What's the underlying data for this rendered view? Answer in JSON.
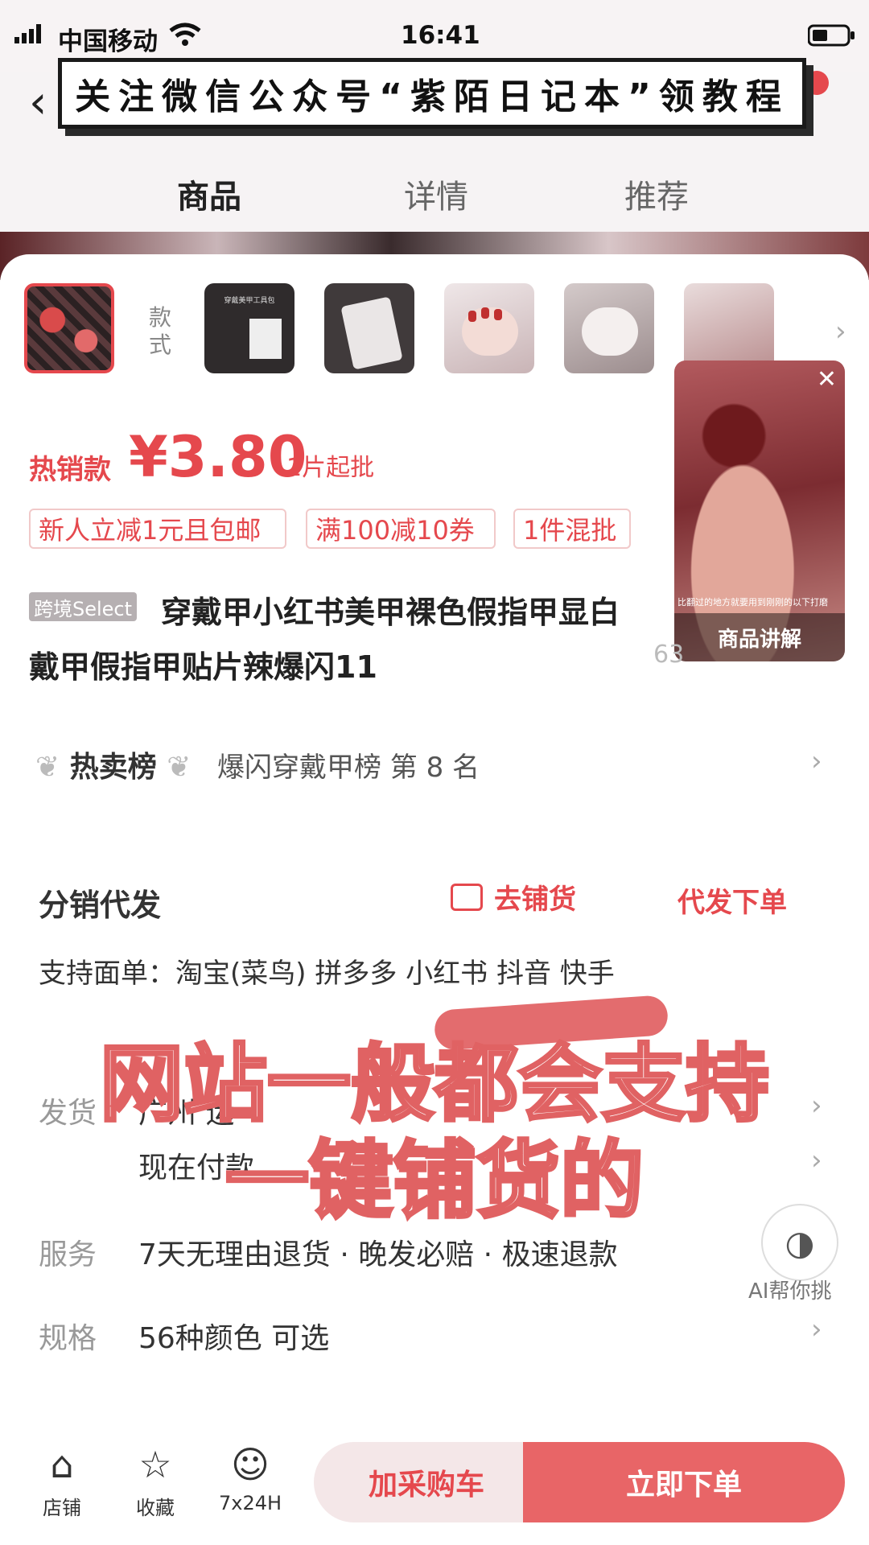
{
  "status_bar": {
    "carrier": "中国移动",
    "time": "16:41"
  },
  "banner": {
    "text": "关注微信公众号“紫陌日记本”领教程"
  },
  "tabs": [
    {
      "label": "商品"
    },
    {
      "label": "详情"
    },
    {
      "label": "推荐"
    }
  ],
  "thumbnails": {
    "style_label": "款式",
    "tool_caption": "穿戴美甲工具包"
  },
  "video": {
    "caption": "商品讲解",
    "subtitle": "比翻过的地方就要用到刚刚的以下打磨"
  },
  "price": {
    "hot_label": "热销款",
    "amount": "¥3.80",
    "moq": "1片起批"
  },
  "chips": [
    "新人立减1元且包邮",
    "满100减10券",
    "1件混批"
  ],
  "product": {
    "badge": "跨境Select",
    "title_line1": "穿戴甲小红书美甲裸色假指甲显白",
    "title_line2": "戴甲假指甲贴片辣爆闪11",
    "sold_partial": "63"
  },
  "ranking": {
    "badge": "热卖榜",
    "text": "爆闪穿戴甲榜  第 8 名"
  },
  "distribution": {
    "title": "分销代发",
    "stock_button": "去铺货",
    "order_button": "代发下单",
    "support": "支持面单：淘宝(菜鸟) 拼多多 小红书 抖音 快手"
  },
  "rows": {
    "ship_label": "发货",
    "ship_value": "广州     运",
    "ship_time": "现在付款",
    "service_label": "服务",
    "service_value": "7天无理由退货 · 晚发必赔 · 极速退款",
    "spec_label": "规格",
    "spec_value": "56种颜色 可选"
  },
  "overlay": {
    "line1": "网站一般都会支持",
    "line2": "一键铺货的"
  },
  "ai": {
    "label": "AI帮你挑"
  },
  "bottom_bar": {
    "shop": "店铺",
    "favorite": "收藏",
    "service": "7x24H",
    "add_cart": "加采购车",
    "buy_now": "立即下单"
  },
  "colors": {
    "accent": "#e5484d",
    "buy_button": "#e86567",
    "cart_button_bg": "#f4e7e8"
  },
  "icons": {
    "back": "chevron-left-icon",
    "wifi": "wifi-icon",
    "battery": "battery-icon",
    "shop": "shop-icon",
    "favorite": "star-icon",
    "service": "chat-face-icon"
  }
}
